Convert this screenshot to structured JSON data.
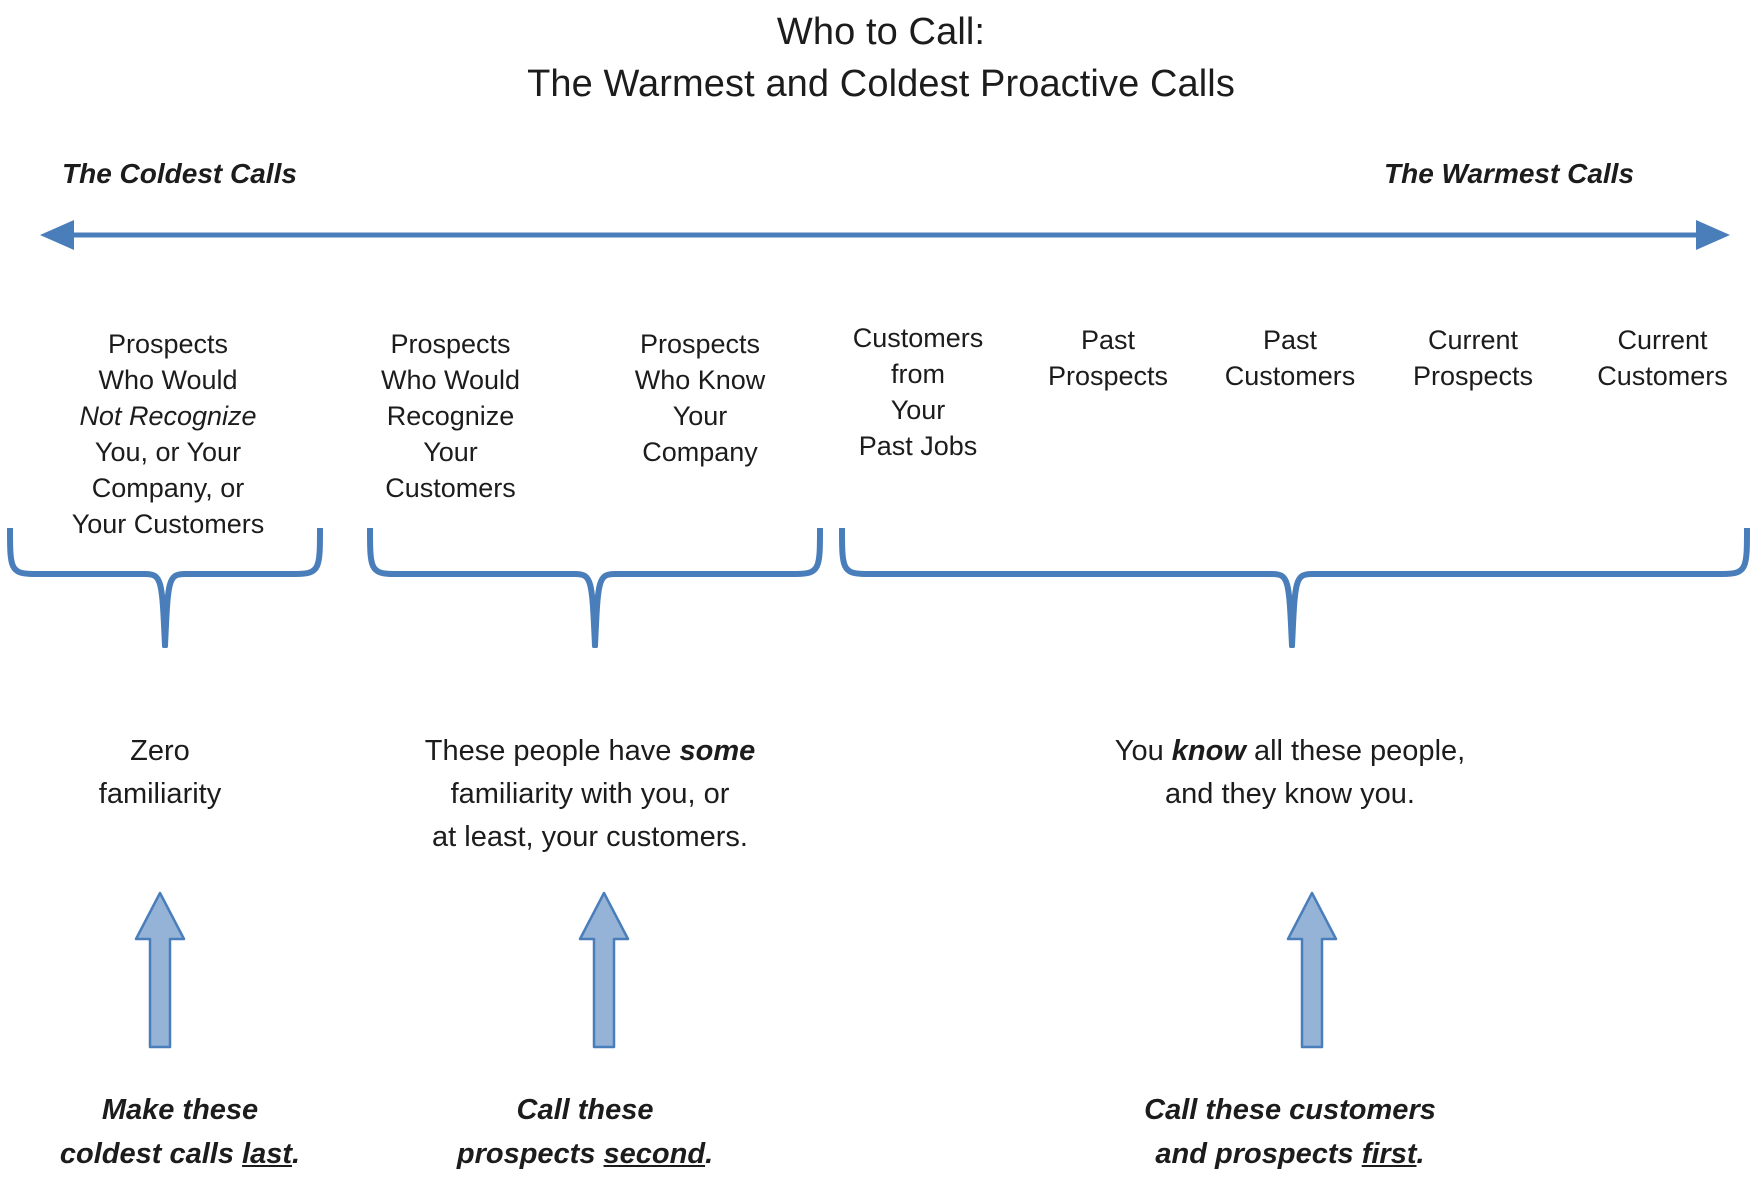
{
  "title": {
    "line1": "Who to Call:",
    "line2": "The Warmest and Coldest Proactive Calls"
  },
  "spectrum": {
    "left_label": "The Coldest Calls",
    "right_label": "The Warmest Calls",
    "arrow_color": "#4a7ebb",
    "direction": "double-headed-horizontal"
  },
  "categories": [
    {
      "id": "prospects-who-would-not-recognize",
      "lines": [
        {
          "text": "Prospects",
          "style": "normal"
        },
        {
          "text": "Who Would",
          "style": "normal"
        },
        {
          "text": "Not Recognize",
          "style": "italic"
        },
        {
          "text": "You, or Your",
          "style": "normal"
        },
        {
          "text": "Company, or",
          "style": "normal"
        },
        {
          "text": "Your Customers",
          "style": "normal"
        }
      ]
    },
    {
      "id": "prospects-who-would-recognize",
      "lines": [
        {
          "text": "Prospects",
          "style": "normal"
        },
        {
          "text": "Who Would",
          "style": "normal"
        },
        {
          "text": "Recognize",
          "style": "normal"
        },
        {
          "text": "Your",
          "style": "normal"
        },
        {
          "text": "Customers",
          "style": "normal"
        }
      ]
    },
    {
      "id": "prospects-who-know-your-company",
      "lines": [
        {
          "text": "Prospects",
          "style": "normal"
        },
        {
          "text": "Who Know",
          "style": "normal"
        },
        {
          "text": "Your",
          "style": "normal"
        },
        {
          "text": "Company",
          "style": "normal"
        }
      ]
    },
    {
      "id": "customers-from-your-past-jobs",
      "lines": [
        {
          "text": "Customers",
          "style": "normal"
        },
        {
          "text": "from",
          "style": "normal"
        },
        {
          "text": "Your",
          "style": "normal"
        },
        {
          "text": "Past Jobs",
          "style": "normal"
        }
      ]
    },
    {
      "id": "past-prospects",
      "lines": [
        {
          "text": "Past",
          "style": "normal"
        },
        {
          "text": "Prospects",
          "style": "normal"
        }
      ]
    },
    {
      "id": "past-customers",
      "lines": [
        {
          "text": "Past",
          "style": "normal"
        },
        {
          "text": "Customers",
          "style": "normal"
        }
      ]
    },
    {
      "id": "current-prospects",
      "lines": [
        {
          "text": "Current",
          "style": "normal"
        },
        {
          "text": "Prospects",
          "style": "normal"
        }
      ]
    },
    {
      "id": "current-customers",
      "lines": [
        {
          "text": "Current",
          "style": "normal"
        },
        {
          "text": "Customers",
          "style": "normal"
        }
      ]
    }
  ],
  "groups": [
    {
      "id": "coldest-group",
      "caption_lines": [
        [
          {
            "text": "Zero",
            "style": "normal"
          }
        ],
        [
          {
            "text": "familiarity",
            "style": "normal"
          }
        ]
      ],
      "action_lines": [
        [
          {
            "text": "Make these",
            "style": "bold-italic"
          }
        ],
        [
          {
            "text": "coldest calls ",
            "style": "bold-italic"
          },
          {
            "text": "last",
            "style": "bold-italic-underline"
          },
          {
            "text": ".",
            "style": "bold-italic"
          }
        ]
      ]
    },
    {
      "id": "some-familiarity-group",
      "caption_lines": [
        [
          {
            "text": "These people have ",
            "style": "normal"
          },
          {
            "text": "some",
            "style": "bold-italic"
          }
        ],
        [
          {
            "text": "familiarity with you, or",
            "style": "normal"
          }
        ],
        [
          {
            "text": "at least, your customers.",
            "style": "normal"
          }
        ]
      ],
      "action_lines": [
        [
          {
            "text": "Call these",
            "style": "bold-italic"
          }
        ],
        [
          {
            "text": "prospects ",
            "style": "bold-italic"
          },
          {
            "text": "second",
            "style": "bold-italic-underline"
          },
          {
            "text": ".",
            "style": "bold-italic"
          }
        ]
      ]
    },
    {
      "id": "known-people-group",
      "caption_lines": [
        [
          {
            "text": "You ",
            "style": "normal"
          },
          {
            "text": "know",
            "style": "bold-italic"
          },
          {
            "text": " all these people,",
            "style": "normal"
          }
        ],
        [
          {
            "text": "and they know you.",
            "style": "normal"
          }
        ]
      ],
      "action_lines": [
        [
          {
            "text": "Call these customers",
            "style": "bold-italic"
          }
        ],
        [
          {
            "text": "and prospects ",
            "style": "bold-italic"
          },
          {
            "text": "first",
            "style": "bold-italic-underline"
          },
          {
            "text": ".",
            "style": "bold-italic"
          }
        ]
      ]
    }
  ],
  "colors": {
    "line_blue": "#4a7ebb",
    "arrow_fill": "#95b3d7",
    "arrow_stroke": "#4a7ebb",
    "text": "#1c1c1c",
    "background": "#ffffff"
  }
}
